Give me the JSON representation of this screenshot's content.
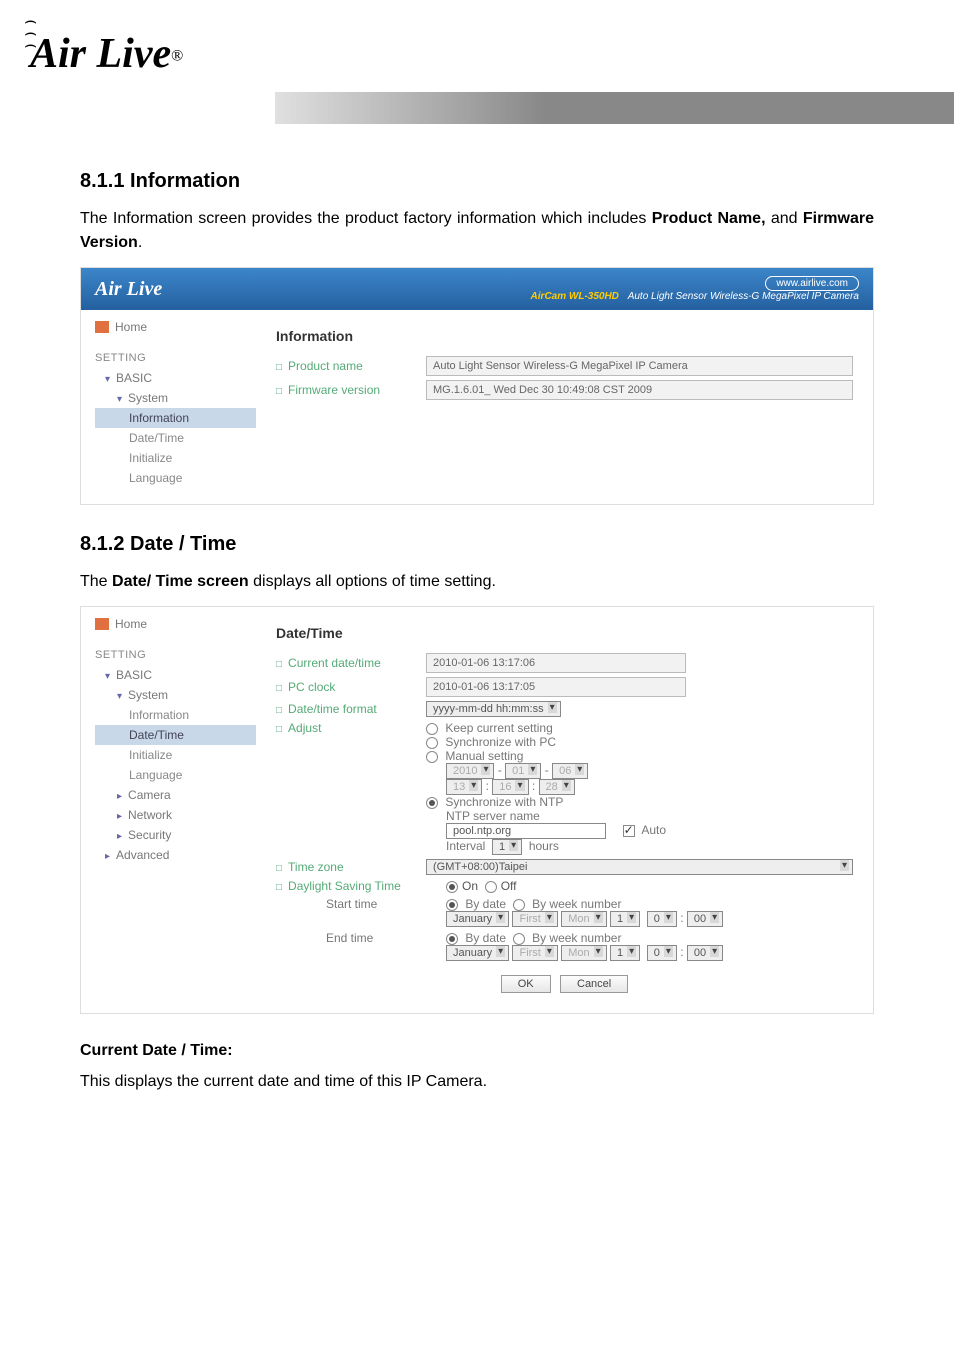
{
  "logo": {
    "text": "Air Live",
    "reg": "®"
  },
  "sections": {
    "info": {
      "heading": "8.1.1 Information",
      "para_prefix": "The Information screen provides the product factory information which includes ",
      "para_bold1": "Product Name,",
      "para_mid": " and ",
      "para_bold2": "Firmware Version",
      "para_suffix": "."
    },
    "datetime": {
      "heading": "8.1.2 Date / Time",
      "para_prefix": "The ",
      "para_bold": "Date/ Time screen",
      "para_suffix": " displays all options of time setting."
    },
    "current": {
      "heading": "Current Date / Time:",
      "para": "This displays the current date and time of this IP Camera."
    }
  },
  "panel1": {
    "brand": "Air Live",
    "pill": "www.airlive.com",
    "model": "AirCam WL-350HD",
    "desc": "Auto Light Sensor Wireless-G MegaPixel IP Camera",
    "home": "Home",
    "setting": "SETTING",
    "basic": "BASIC",
    "system": "System",
    "leaves": [
      "Information",
      "Date/Time",
      "Initialize",
      "Language"
    ],
    "content_title": "Information",
    "rows": {
      "product_label": "Product name",
      "product_val": "Auto Light Sensor Wireless-G MegaPixel IP Camera",
      "fw_label": "Firmware version",
      "fw_val": "MG.1.6.01_ Wed Dec 30 10:49:08 CST 2009"
    }
  },
  "panel2": {
    "home": "Home",
    "setting": "SETTING",
    "basic": "BASIC",
    "system": "System",
    "leaves": [
      "Information",
      "Date/Time",
      "Initialize",
      "Language"
    ],
    "camera": "Camera",
    "network": "Network",
    "security": "Security",
    "advanced": "Advanced",
    "content_title": "Date/Time",
    "rows": {
      "current_label": "Current date/time",
      "current_val": "2010-01-06   13:17:06",
      "pc_label": "PC clock",
      "pc_val": "2010-01-06   13:17:05",
      "fmt_label": "Date/time format",
      "fmt_val": "yyyy-mm-dd hh:mm:ss",
      "adj_label": "Adjust",
      "adj_keep": "Keep current setting",
      "adj_sync_pc": "Synchronize with PC",
      "adj_manual": "Manual setting",
      "adj_manual_y": "2010",
      "adj_manual_m": "01",
      "adj_manual_d": "06",
      "adj_manual_hh": "13",
      "adj_manual_mm": "16",
      "adj_manual_ss": "28",
      "adj_sync_ntp": "Synchronize with NTP",
      "ntp_label": "NTP server name",
      "ntp_val": "pool.ntp.org",
      "auto": "Auto",
      "interval": "Interval",
      "interval_val": "1",
      "interval_unit": "hours",
      "tz_label": "Time zone",
      "tz_val": "(GMT+08:00)Taipei",
      "dst_label": "Daylight Saving Time",
      "on": "On",
      "off": "Off",
      "start": "Start time",
      "end": "End time",
      "bydate": "By date",
      "byweek": "By week number",
      "month": "January",
      "first": "First",
      "mon": "Mon",
      "one": "1",
      "zero": "0",
      "dzero": "00",
      "ok": "OK",
      "cancel": "Cancel"
    }
  }
}
